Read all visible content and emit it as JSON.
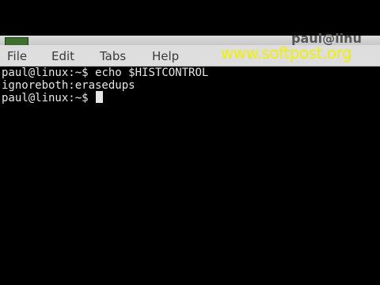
{
  "window": {
    "title": "paul@linu"
  },
  "menubar": {
    "items": [
      {
        "label": "File"
      },
      {
        "label": "Edit"
      },
      {
        "label": "Tabs"
      },
      {
        "label": "Help"
      }
    ]
  },
  "watermark": {
    "text": "www.softpost.org",
    "color": "#f0f000"
  },
  "terminal": {
    "lines": [
      {
        "prompt": "paul@linux:~$",
        "command": "echo $HISTCONTROL"
      },
      {
        "output": "ignoreboth:erasedups"
      },
      {
        "prompt": "paul@linux:~$",
        "command": ""
      }
    ],
    "text_color": "#e6e6e6",
    "background": "#000000"
  }
}
